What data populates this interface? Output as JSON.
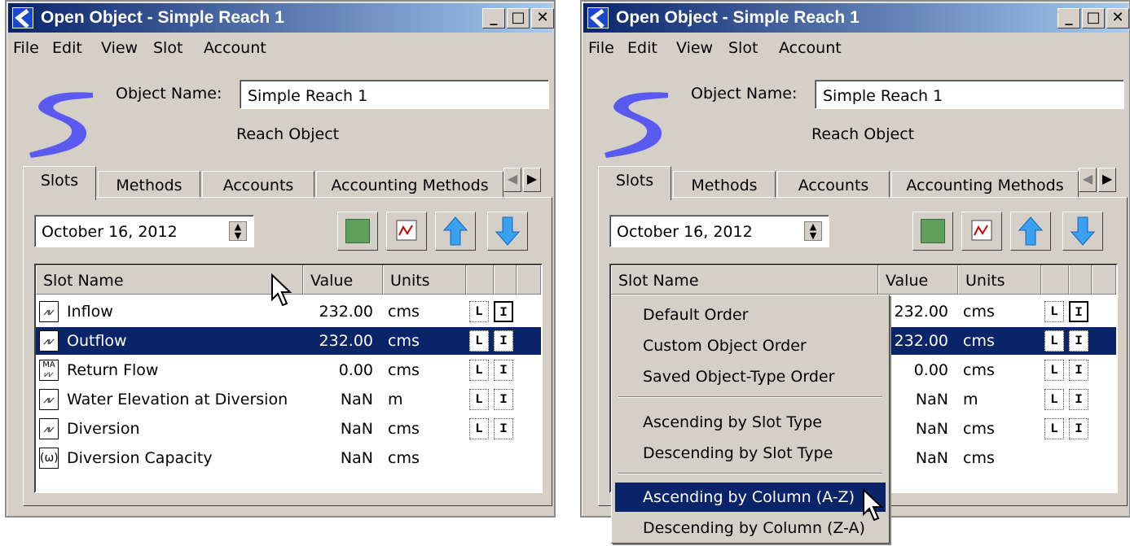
{
  "windows": [
    {
      "title": "Open Object - Simple Reach 1",
      "menu": [
        "File",
        "Edit",
        "View",
        "Slot",
        "Account"
      ],
      "object_name_label": "Object Name:",
      "object_name_value": "Simple Reach 1",
      "object_type": "Reach Object",
      "tabs": [
        "Slots",
        "Methods",
        "Accounts",
        "Accounting Methods"
      ],
      "date": "October 16, 2012",
      "columns": [
        "Slot Name",
        "Value",
        "Units"
      ],
      "rows": [
        {
          "name": "Inflow",
          "value": "232.00",
          "units": "cms"
        },
        {
          "name": "Outflow",
          "value": "232.00",
          "units": "cms"
        },
        {
          "name": "Return Flow",
          "value": "0.00",
          "units": "cms"
        },
        {
          "name": "Water Elevation at Diversion",
          "value": "NaN",
          "units": "m"
        },
        {
          "name": "Diversion",
          "value": "NaN",
          "units": "cms"
        },
        {
          "name": "Diversion Capacity",
          "value": "NaN",
          "units": "cms"
        }
      ]
    },
    {
      "title": "Open Object - Simple Reach 1",
      "menu": [
        "File",
        "Edit",
        "View",
        "Slot",
        "Account"
      ],
      "object_name_label": "Object Name:",
      "object_name_value": "Simple Reach 1",
      "object_type": "Reach Object",
      "tabs": [
        "Slots",
        "Methods",
        "Accounts",
        "Accounting Methods"
      ],
      "date": "October 16, 2012",
      "columns": [
        "Slot Name",
        "Value",
        "Units"
      ],
      "rows": [
        {
          "value": "232.00",
          "units": "cms"
        },
        {
          "value": "232.00",
          "units": "cms"
        },
        {
          "value": "0.00",
          "units": "cms"
        },
        {
          "value": "NaN",
          "units": "m"
        },
        {
          "value": "NaN",
          "units": "cms"
        },
        {
          "value": "NaN",
          "units": "cms"
        }
      ]
    }
  ],
  "context_menu": {
    "items": [
      "Default Order",
      "Custom Object Order",
      "Saved Object-Type Order",
      "Ascending by Slot Type",
      "Descending by Slot Type",
      "Ascending by Column (A-Z)",
      "Descending by Column (Z-A)"
    ]
  },
  "colors": {
    "title_bar": "#0a246a",
    "selection": "#0a246a",
    "window_face": "#d4d0c8",
    "logo": "#5a5af0"
  },
  "icons": {
    "minimize": "minimize-icon",
    "maximize": "maximize-icon",
    "close": "close-icon",
    "color_tool": "color-square-icon",
    "plot_tool": "plot-icon",
    "move_up": "arrow-up-icon",
    "move_down": "arrow-down-icon"
  }
}
